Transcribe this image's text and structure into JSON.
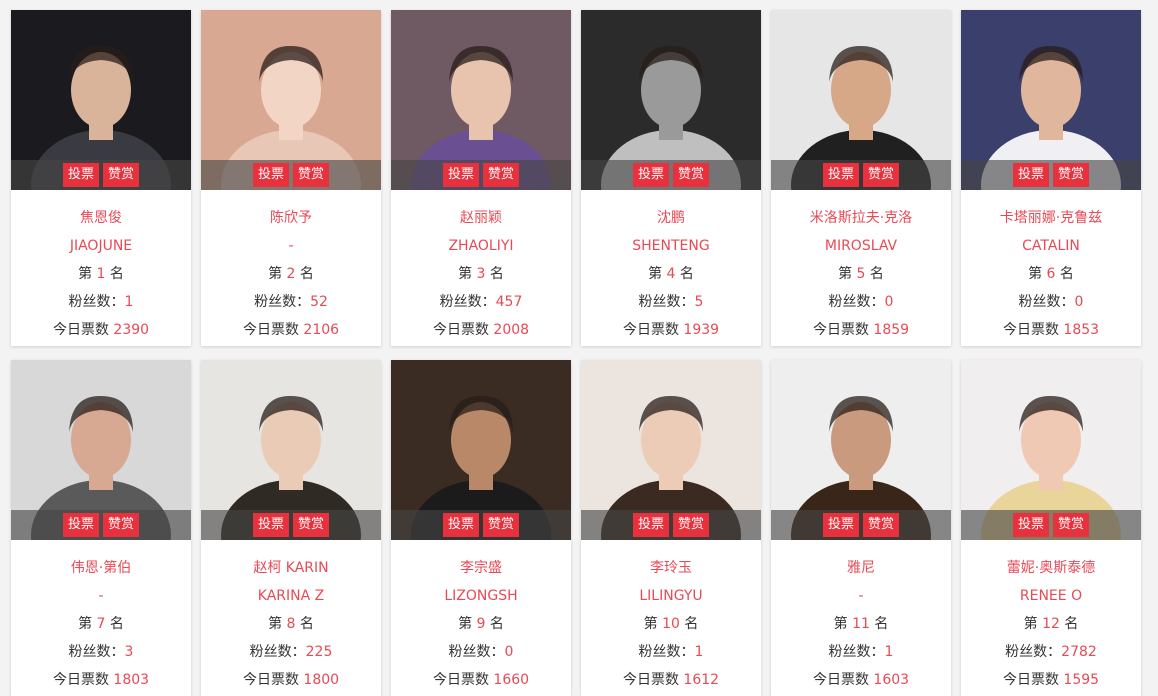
{
  "labels": {
    "vote": "投票",
    "reward": "赞赏",
    "rank_prefix": "第",
    "rank_suffix": "名",
    "fans_prefix": "粉丝数：",
    "today_prefix": "今日票数"
  },
  "colors": {
    "accent": "#e8313c",
    "text_red": "#e84a55"
  },
  "cards": [
    {
      "name": "焦恩俊",
      "sub": "JIAOJUNE",
      "rank": "1",
      "fans": "1",
      "votes": "2390",
      "bg": "#1b1b1f",
      "fg": "#3a3a42",
      "skin": "#d9b39a"
    },
    {
      "name": "陈欣予",
      "sub": "-",
      "rank": "2",
      "fans": "52",
      "votes": "2106",
      "bg": "#d9a892",
      "fg": "#e9c7b7",
      "skin": "#f3d5c6"
    },
    {
      "name": "赵丽颖",
      "sub": "ZHAOLIYI",
      "rank": "3",
      "fans": "457",
      "votes": "2008",
      "bg": "#6f5a63",
      "fg": "#6b4f93",
      "skin": "#e8c4ae"
    },
    {
      "name": "沈鹏",
      "sub": "SHENTENG",
      "rank": "4",
      "fans": "5",
      "votes": "1939",
      "bg": "#2b2b2b",
      "fg": "#bfbfbf",
      "skin": "#9a9a9a"
    },
    {
      "name": "米洛斯拉夫·克洛",
      "sub": "MIROSLAV",
      "rank": "5",
      "fans": "0",
      "votes": "1859",
      "bg": "#e6e6e6",
      "fg": "#202020",
      "skin": "#d6a888"
    },
    {
      "name": "卡塔丽娜·克鲁兹",
      "sub": "CATALIN",
      "rank": "6",
      "fans": "0",
      "votes": "1853",
      "bg": "#3a3f6b",
      "fg": "#f0f0f4",
      "skin": "#e0b79c"
    },
    {
      "name": "伟恩·第伯",
      "sub": "-",
      "rank": "7",
      "fans": "3",
      "votes": "1803",
      "bg": "#d8d8d8",
      "fg": "#5a5a5a",
      "skin": "#d7a992"
    },
    {
      "name": "赵柯 KARIN",
      "sub": "KARINA Z",
      "rank": "8",
      "fans": "225",
      "votes": "1800",
      "bg": "#e7e5e1",
      "fg": "#2f2a24",
      "skin": "#eacbb5"
    },
    {
      "name": "李宗盛",
      "sub": "LIZONGSH",
      "rank": "9",
      "fans": "0",
      "votes": "1660",
      "bg": "#3a2b23",
      "fg": "#1b1b1b",
      "skin": "#b98869"
    },
    {
      "name": "李玲玉",
      "sub": "LILINGYU",
      "rank": "10",
      "fans": "1",
      "votes": "1612",
      "bg": "#ebe4df",
      "fg": "#3a2a22",
      "skin": "#ecccb7"
    },
    {
      "name": "雅尼",
      "sub": "-",
      "rank": "11",
      "fans": "1",
      "votes": "1603",
      "bg": "#eeeeee",
      "fg": "#3a2519",
      "skin": "#c99a7d"
    },
    {
      "name": "蕾妮·奥斯泰德",
      "sub": "RENEE O",
      "rank": "12",
      "fans": "2782",
      "votes": "1595",
      "bg": "#f1eef0",
      "fg": "#e9d59a",
      "skin": "#efc9b3"
    }
  ]
}
